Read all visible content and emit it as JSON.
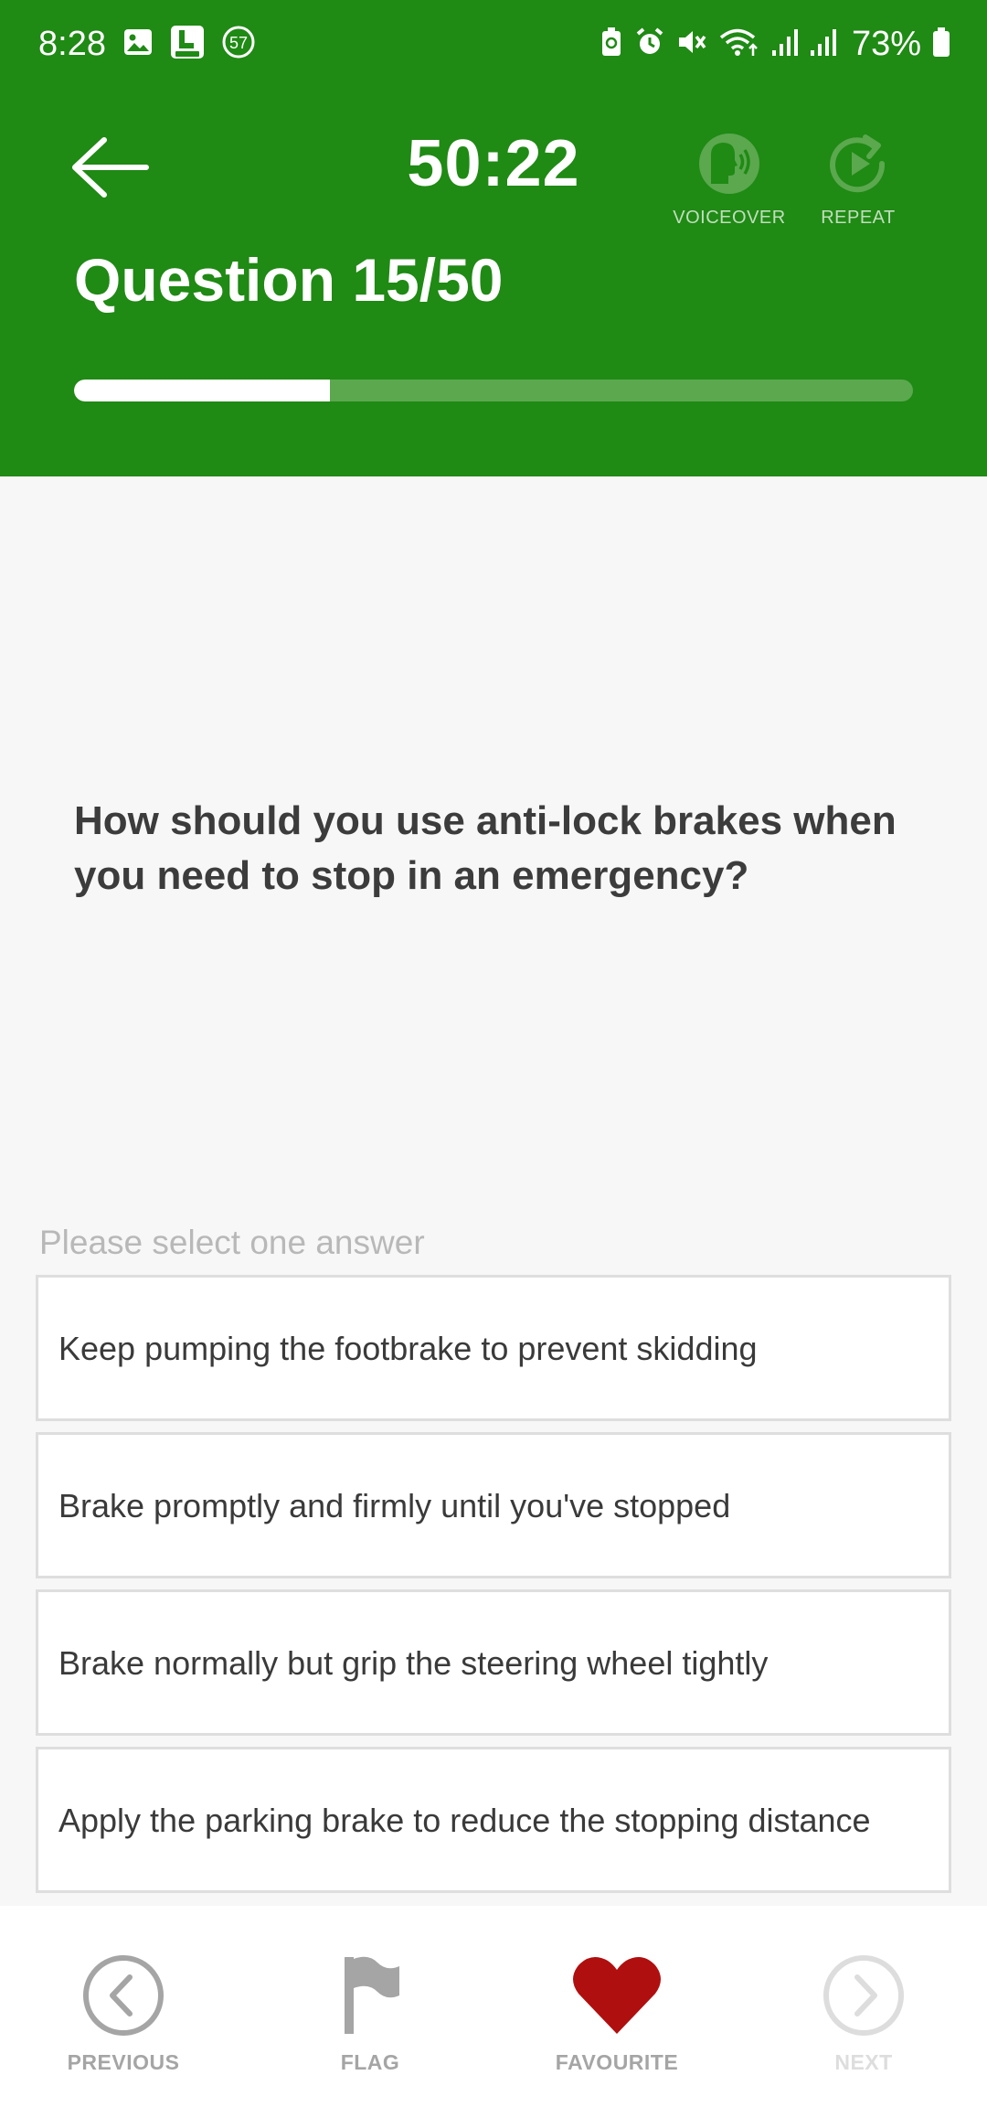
{
  "status_bar": {
    "time": "8:28",
    "notification_count": "57",
    "battery": "73%",
    "left_icons": [
      "gallery-icon",
      "4in1-app-icon",
      "badge-57-icon"
    ],
    "right_icons": [
      "battery-saver-icon",
      "alarm-icon",
      "mute-icon",
      "wifi-icon",
      "signal-icon",
      "signal-icon",
      "battery-icon"
    ]
  },
  "header": {
    "timer": "50:22",
    "voiceover_label": "VOICEOVER",
    "repeat_label": "REPEAT",
    "question_number": "Question 15/50",
    "progress_fraction": 0.305,
    "color": "#1f8a14"
  },
  "question": {
    "text": "How should you use anti-lock brakes when you need to stop in an emergency?",
    "instruction": "Please select one answer"
  },
  "answers": [
    "Keep pumping the footbrake to prevent skidding",
    "Brake promptly and firmly until you've stopped",
    "Brake normally but grip the steering wheel tightly",
    "Apply the parking brake to reduce the stopping distance"
  ],
  "bottom_nav": {
    "previous_label": "PREVIOUS",
    "flag_label": "FLAG",
    "favourite_label": "FAVOURITE",
    "next_label": "NEXT",
    "favourite_color": "#b00f0f"
  }
}
